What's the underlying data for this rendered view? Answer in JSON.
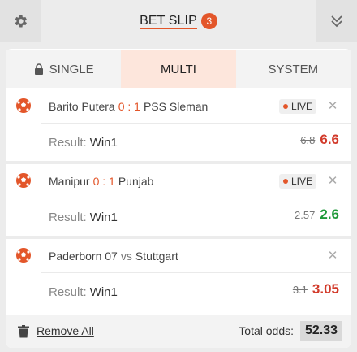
{
  "header": {
    "title": "BET SLIP",
    "badge_count": "3",
    "settings_icon": "gear-icon",
    "collapse_icon": "double-chevron-down-icon",
    "accent_color": "#e3562a"
  },
  "tabs": [
    {
      "label": "SINGLE",
      "icon": "lock-icon",
      "active": false
    },
    {
      "label": "MULTI",
      "active": true
    },
    {
      "label": "SYSTEM",
      "active": false
    }
  ],
  "bets": [
    {
      "home": "Barito Putera",
      "score": "0 : 1",
      "away": "PSS Sleman",
      "live_label": "LIVE",
      "result_label": "Result:",
      "result_value": "Win1",
      "old_odds": "6.8",
      "new_odds": "6.6",
      "trend": "down"
    },
    {
      "home": "Manipur",
      "score": "0 : 1",
      "away": "Punjab",
      "live_label": "LIVE",
      "result_label": "Result:",
      "result_value": "Win1",
      "old_odds": "2.57",
      "new_odds": "2.6",
      "trend": "up"
    },
    {
      "home": "Paderborn 07",
      "vs": "vs",
      "away": "Stuttgart",
      "result_label": "Result:",
      "result_value": "Win1",
      "old_odds": "3.1",
      "new_odds": "3.05",
      "trend": "down"
    }
  ],
  "footer": {
    "remove_all_label": "Remove All",
    "total_odds_label": "Total odds:",
    "total_odds_value": "52.33"
  }
}
